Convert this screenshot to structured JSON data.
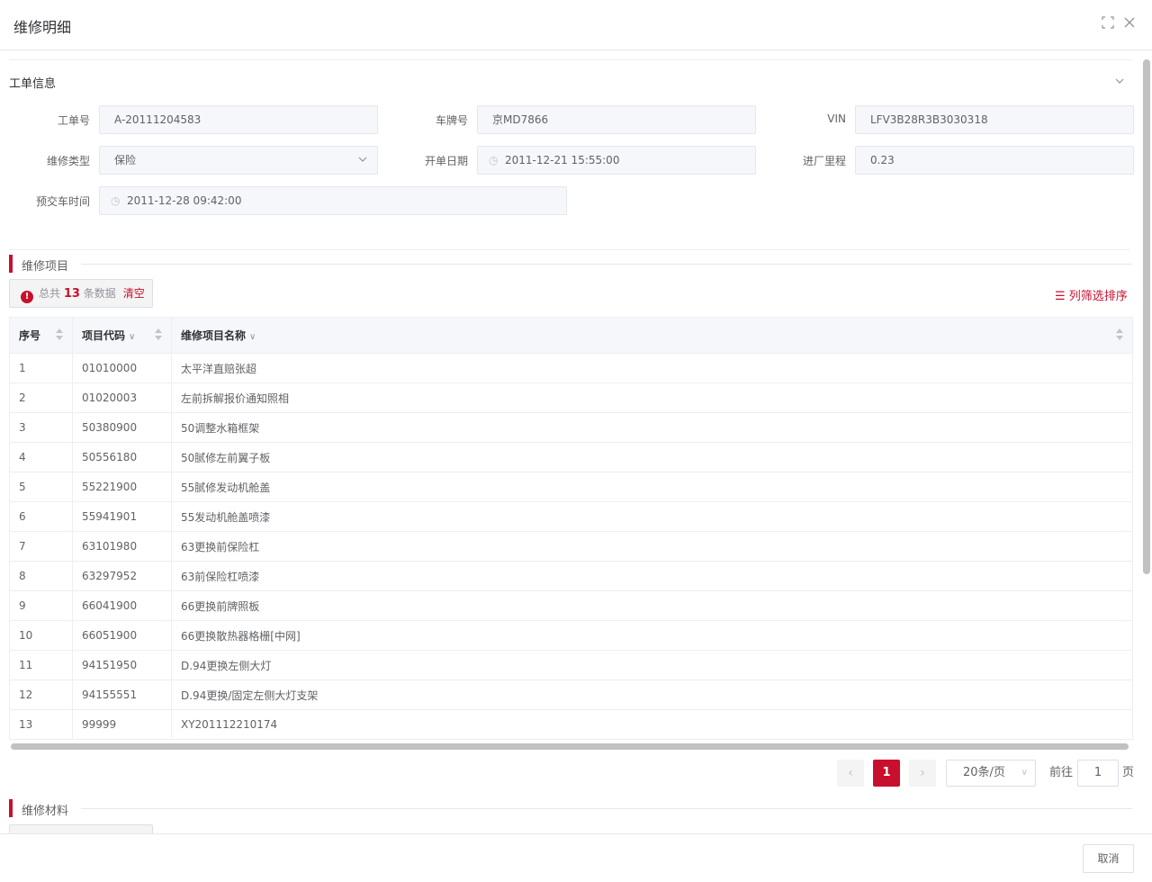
{
  "dialog": {
    "title": "维修明细",
    "maximize_icon": "maximize-icon",
    "close_icon": "close-icon"
  },
  "work_order_section": {
    "title": "工单信息",
    "fields": {
      "order_no": {
        "label": "工单号",
        "value": "A-20111204583"
      },
      "plate": {
        "label": "车牌号",
        "value": "京MD7866"
      },
      "vin": {
        "label": "VIN",
        "value": "LFV3B28R3B3030318"
      },
      "repair_type": {
        "label": "维修类型",
        "value": "保险"
      },
      "open_date": {
        "label": "开单日期",
        "value": "2011-12-21 15:55:00"
      },
      "mileage": {
        "label": "进厂里程",
        "value": "0.23"
      },
      "delivery_time": {
        "label": "预交车时间",
        "value": "2011-12-28 09:42:00"
      }
    }
  },
  "repair_items": {
    "title": "维修项目",
    "alert": {
      "prefix": "总共",
      "count": "13",
      "suffix": "条数据",
      "clear": "清空"
    },
    "column_sort": "列筛选排序",
    "columns": [
      "序号",
      "项目代码",
      "维修项目名称"
    ],
    "rows": [
      [
        "1",
        "01010000",
        "太平洋直赔张超"
      ],
      [
        "2",
        "01020003",
        "左前拆解报价通知照相"
      ],
      [
        "3",
        "50380900",
        "50调整水箱框架"
      ],
      [
        "4",
        "50556180",
        "50腻修左前翼子板"
      ],
      [
        "5",
        "55221900",
        "55腻修发动机舱盖"
      ],
      [
        "6",
        "55941901",
        "55发动机舱盖喷漆"
      ],
      [
        "7",
        "63101980",
        "63更换前保险杠"
      ],
      [
        "8",
        "63297952",
        "63前保险杠喷漆"
      ],
      [
        "9",
        "66041900",
        "66更换前牌照板"
      ],
      [
        "10",
        "66051900",
        "66更换散热器格栅[中网]"
      ],
      [
        "11",
        "94151950",
        "D.94更换左侧大灯"
      ],
      [
        "12",
        "94155551",
        "D.94更换/固定左侧大灯支架"
      ],
      [
        "13",
        "99999",
        "XY201112210174"
      ]
    ],
    "pagination": {
      "current_page": "1",
      "page_size": "20条/页",
      "goto_prefix": "前往",
      "goto_value": "1",
      "goto_suffix": "页"
    }
  },
  "repair_materials": {
    "title": "维修材料"
  },
  "footer": {
    "cancel": "取消"
  },
  "colors": {
    "accent": "#c8102e",
    "border": "#dcdfe6",
    "input_bg": "#f5f7fa"
  }
}
